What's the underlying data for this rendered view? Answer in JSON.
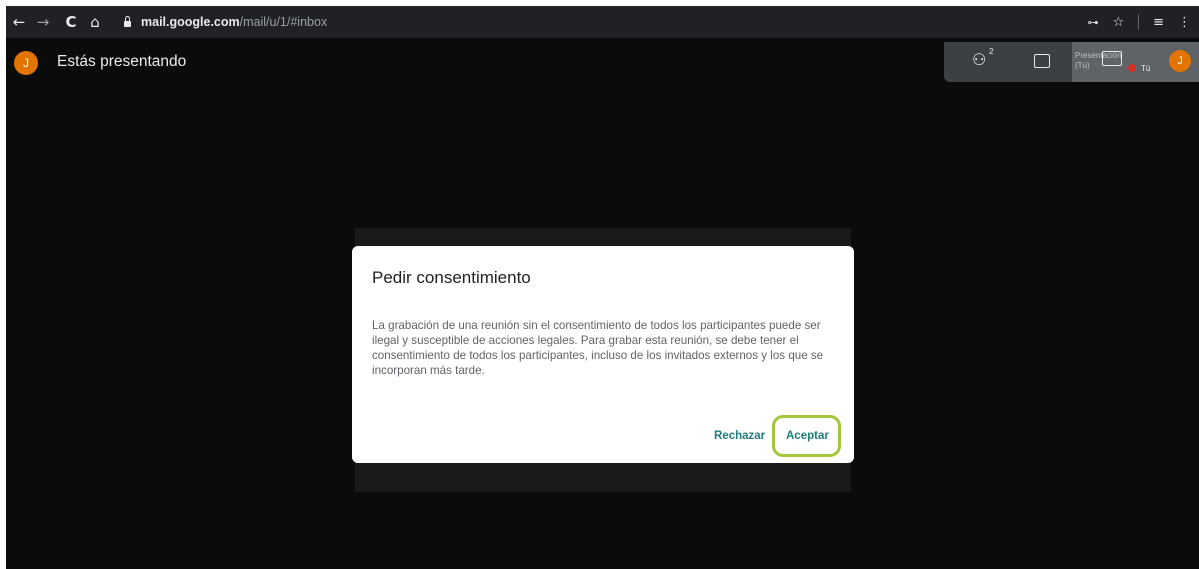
{
  "browser": {
    "back": "←",
    "forward": "→",
    "reload": "C",
    "home": "⌂",
    "url_host": "mail.google.com",
    "url_path": "/mail/u/1/#inbox",
    "key_icon": "key-icon",
    "star_icon": "☆",
    "media_icon": "≡",
    "menu_icon": "⋮"
  },
  "meet": {
    "avatar_initial": "J",
    "presenting_text": "Estás presentando",
    "people_count": "2",
    "presentation_label_1": "Presentación",
    "presentation_label_2": "(Tú)",
    "self_label": "Tú",
    "self_initial": "J"
  },
  "dialog": {
    "title": "Pedir consentimiento",
    "body": "La grabación de una reunión sin el consentimiento de todos los participantes puede ser ilegal y susceptible de acciones legales. Para grabar esta reunión, se debe tener el consentimiento de todos los participantes, incluso de los invitados externos y los que se incorporan más tarde.",
    "reject_label": "Rechazar",
    "accept_label": "Aceptar"
  },
  "colors": {
    "highlight": "#a4c639",
    "avatar": "#e37400",
    "button_text": "#1e7d7a"
  }
}
